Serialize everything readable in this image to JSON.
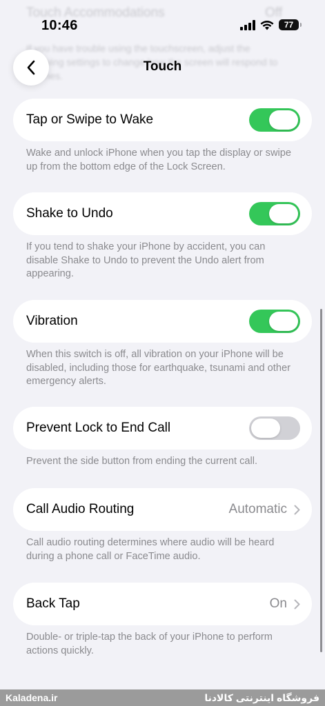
{
  "ghost": {
    "title": "Touch Accommodations",
    "value": "Off",
    "description": "If you have trouble using the touchscreen, adjust the following settings to change how the screen will respond to touches."
  },
  "status_bar": {
    "time": "10:46",
    "battery": "77"
  },
  "nav": {
    "title": "Touch"
  },
  "rows": [
    {
      "label": "Tap or Swipe to Wake",
      "toggle": true,
      "description": "Wake and unlock iPhone when you tap the display or swipe up from the bottom edge of the Lock Screen."
    },
    {
      "label": "Shake to Undo",
      "toggle": true,
      "description": "If you tend to shake your iPhone by accident, you can disable Shake to Undo to prevent the Undo alert from appearing."
    },
    {
      "label": "Vibration",
      "toggle": true,
      "description": "When this switch is off, all vibration on your iPhone will be disabled, including those for earthquake, tsunami and other emergency alerts."
    },
    {
      "label": "Prevent Lock to End Call",
      "toggle": false,
      "description": "Prevent the side button from ending the current call."
    },
    {
      "label": "Call Audio Routing",
      "value": "Automatic",
      "description": "Call audio routing determines where audio will be heard during a phone call or FaceTime audio."
    },
    {
      "label": "Back Tap",
      "value": "On",
      "description": "Double- or triple-tap the back of your iPhone to perform actions quickly."
    }
  ],
  "watermark": {
    "left": "Kaladena.ir",
    "right": "فروشگاه اینترنتی کالادنا"
  },
  "colors": {
    "accent_on": "#34c759",
    "toggle_off": "#d1d1d6",
    "background": "#f2f2f7",
    "secondary_text": "#8a8a8e"
  }
}
